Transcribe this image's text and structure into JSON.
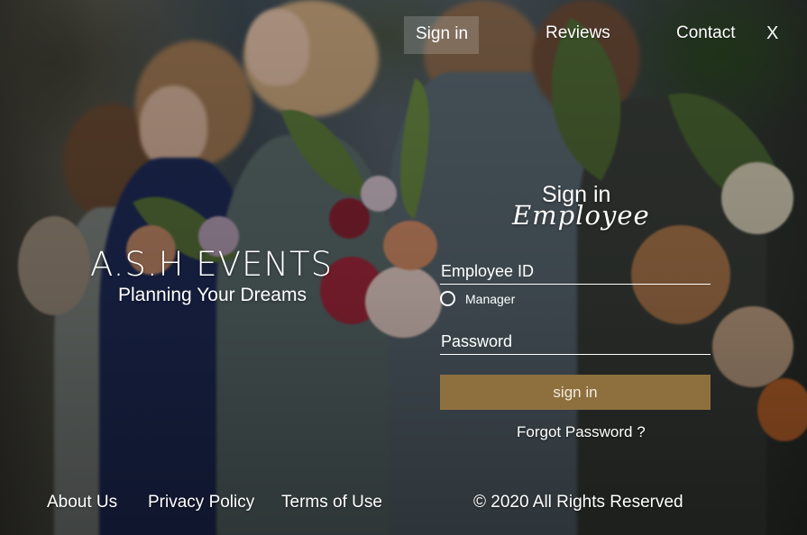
{
  "nav": {
    "signin": "Sign in",
    "reviews": "Reviews",
    "contact": "Contact",
    "close": "X"
  },
  "brand": {
    "title": "A.S.H EVENTS",
    "subtitle": "Planning Your Dreams"
  },
  "form": {
    "heading": "Sign in",
    "subheading": "Employee",
    "employee_id_placeholder": "Employee ID",
    "manager_label": "Manager",
    "password_placeholder": "Password",
    "submit_label": "sign in",
    "forgot_label": "Forgot Password ?"
  },
  "footer": {
    "about": "About Us",
    "privacy": "Privacy Policy",
    "terms": "Terms of Use",
    "copyright": "© 2020 All Rights Reserved"
  },
  "colors": {
    "button_bg": "#8e703f",
    "text": "#ffffff",
    "nav_active_bg": "rgba(255,255,255,0.18)"
  },
  "icons": {
    "radio": "radio-circle-icon",
    "close": "close-icon"
  }
}
